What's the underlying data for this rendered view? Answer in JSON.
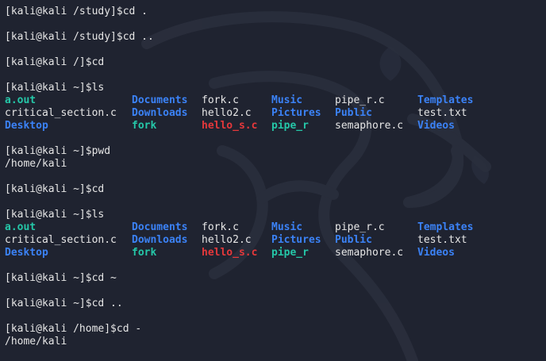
{
  "terminal": {
    "colors": {
      "background": "#1f2330",
      "text": "#e6e6e6",
      "directory": "#3b82f6",
      "executable": "#25c7a8",
      "executable_alt": "#e5383b"
    },
    "sessions": [
      {
        "prompt": "[kali@kali /study]$cd .",
        "output": []
      },
      {
        "prompt": "[kali@kali /study]$cd ..",
        "output": []
      },
      {
        "prompt": "[kali@kali /]$cd",
        "output": []
      },
      {
        "prompt": "[kali@kali ~]$ls",
        "output": []
      },
      {
        "prompt": "[kali@kali ~]$pwd",
        "output": [
          "/home/kali"
        ]
      },
      {
        "prompt": "[kali@kali ~]$cd",
        "output": []
      },
      {
        "prompt": "[kali@kali ~]$ls",
        "output": []
      },
      {
        "prompt": "[kali@kali ~]$cd ~",
        "output": []
      },
      {
        "prompt": "[kali@kali ~]$cd ..",
        "output": []
      },
      {
        "prompt": "[kali@kali /home]$cd -",
        "output": [
          "/home/kali"
        ]
      }
    ],
    "ls_first": {
      "rows": [
        [
          "a.out",
          "Documents",
          "fork.c",
          "Music",
          "pipe_r.c",
          "Templates"
        ],
        [
          "critical_section.c",
          "Downloads",
          "hello2.c",
          "Pictures",
          "Public",
          "test.txt"
        ],
        [
          "Desktop",
          "fork",
          "hello_s.c",
          "pipe_r",
          "semaphore.c",
          "Videos"
        ]
      ]
    },
    "ls_second": {
      "rows": [
        [
          "a.out",
          "Documents",
          "fork.c",
          "Music",
          "pipe_r.c",
          "Templates"
        ],
        [
          "critical_section.c",
          "Downloads",
          "hello2.c",
          "Pictures",
          "Public",
          "test.txt"
        ],
        [
          "Desktop",
          "fork",
          "hello_s.c",
          "pipe_r",
          "semaphore.c",
          "Videos"
        ]
      ]
    }
  }
}
